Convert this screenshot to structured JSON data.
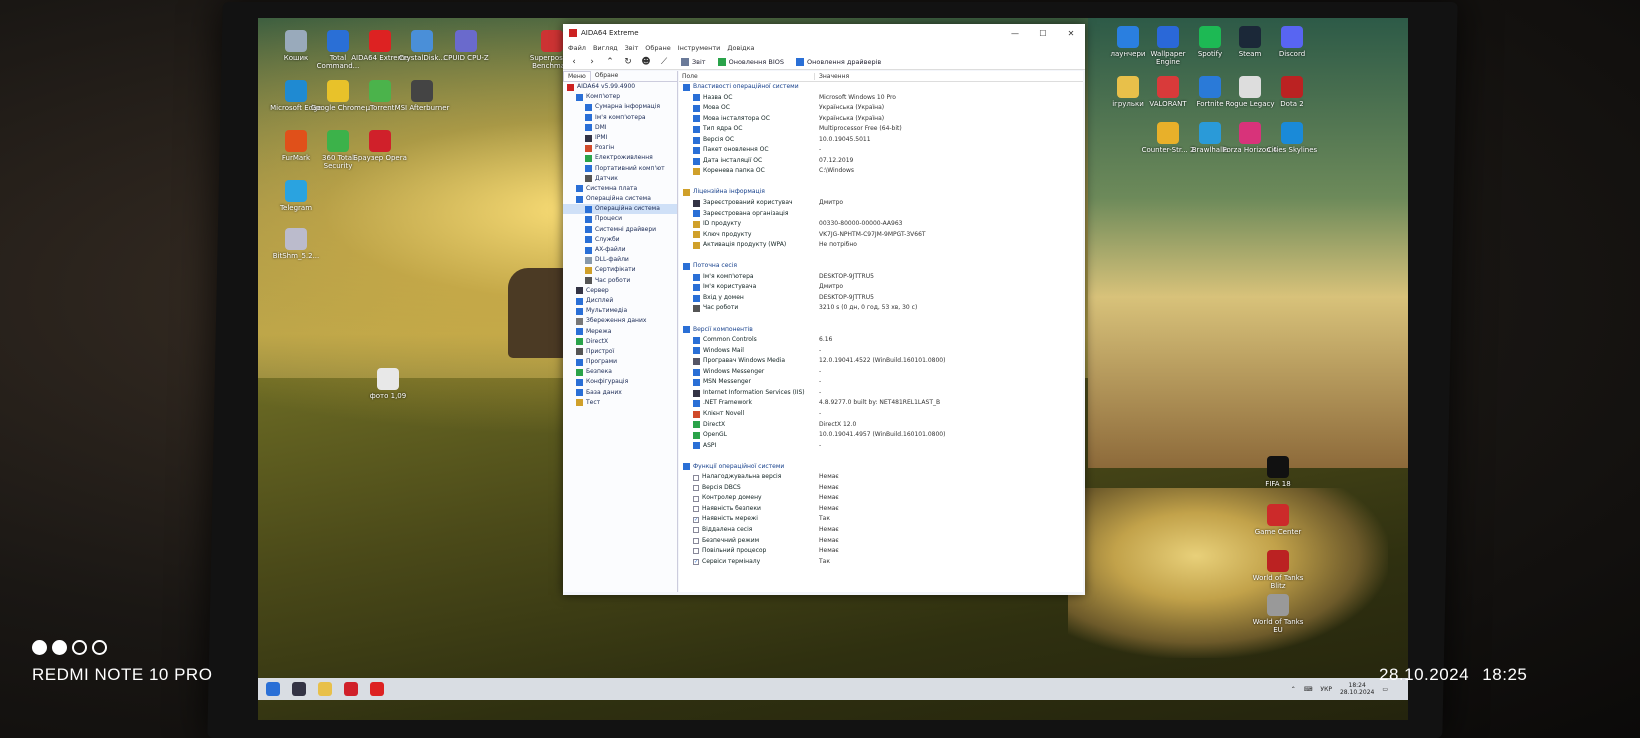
{
  "photo": {
    "device": "REDMI NOTE 10 PRO",
    "timestamp": "28.10.2024 18:25"
  },
  "desktop": {
    "left_icons": [
      {
        "label": "Кошик",
        "color": "#9ab"
      },
      {
        "label": "Total Command...",
        "color": "#2a6fd6"
      },
      {
        "label": "AIDA64 Extreme",
        "color": "#d22"
      },
      {
        "label": "CrystalDisk...",
        "color": "#4a8fd8"
      },
      {
        "label": "CPUID CPU-Z",
        "color": "#6a6acc"
      },
      {
        "label": "Superposit... Benchmark",
        "color": "#c33"
      },
      {
        "label": "Microsoft Edge",
        "color": "#1f8ad2"
      },
      {
        "label": "Google Chrome",
        "color": "#e8c22a"
      },
      {
        "label": "µTorrent",
        "color": "#4bb34b"
      },
      {
        "label": "MSI Afterburner",
        "color": "#444"
      },
      {
        "label": "FurMark",
        "color": "#e0501a"
      },
      {
        "label": "360 Total Security",
        "color": "#3cb24a"
      },
      {
        "label": "Браузер Opera",
        "color": "#d0202a"
      },
      {
        "label": "Telegram",
        "color": "#2aa3e0"
      },
      {
        "label": "BitShm_5.2...",
        "color": "#bbc"
      },
      {
        "label": "фото 1,09",
        "color": "#e8e8e8"
      }
    ],
    "right_icons": [
      {
        "label": "лаунчери",
        "color": "#2a7fe0"
      },
      {
        "label": "Wallpaper Engine",
        "color": "#2a68d8"
      },
      {
        "label": "Spotify",
        "color": "#1db954"
      },
      {
        "label": "Steam",
        "color": "#1b2838"
      },
      {
        "label": "Discord",
        "color": "#5865f2"
      },
      {
        "label": "ігрульки",
        "color": "#e8c04a"
      },
      {
        "label": "VALORANT",
        "color": "#d93a3a"
      },
      {
        "label": "Fortnite",
        "color": "#2a7ad8"
      },
      {
        "label": "Rogue Legacy",
        "color": "#ddd"
      },
      {
        "label": "Dota 2",
        "color": "#b22"
      },
      {
        "label": "Counter-Str... 2",
        "color": "#e8b02a"
      },
      {
        "label": "Brawlhalla",
        "color": "#2a9ad8"
      },
      {
        "label": "Forza Horizon 4",
        "color": "#d8337a"
      },
      {
        "label": "Cities Skylines",
        "color": "#1a8ad8"
      },
      {
        "label": "FIFA 18",
        "color": "#111"
      },
      {
        "label": "Game Center",
        "color": "#cc2a2a"
      },
      {
        "label": "World of Tanks Blitz",
        "color": "#b22"
      },
      {
        "label": "World of Tanks EU",
        "color": "#999"
      }
    ]
  },
  "window": {
    "title": "AIDA64 Extreme",
    "menu": [
      "Файл",
      "Вигляд",
      "Звіт",
      "Обране",
      "Інструменти",
      "Довідка"
    ],
    "toolbar": [
      {
        "label": "Звіт",
        "color": "#6a7a99"
      },
      {
        "label": "Оновлення BIOS",
        "color": "#2aa34a"
      },
      {
        "label": "Оновлення драйверів",
        "color": "#2a6fd6"
      }
    ],
    "left_tabs": [
      "Меню",
      "Обране"
    ],
    "tree": [
      {
        "label": "AIDA64 v5.99.4900",
        "indent": 0,
        "color": "#c22"
      },
      {
        "label": "Комп'ютер",
        "indent": 1,
        "color": "#2a6fd6"
      },
      {
        "label": "Сумарна інформація",
        "indent": 2,
        "color": "#2a6fd6"
      },
      {
        "label": "Ім'я комп'ютера",
        "indent": 2,
        "color": "#2a6fd6"
      },
      {
        "label": "DMI",
        "indent": 2,
        "color": "#2a6fd6"
      },
      {
        "label": "IPMI",
        "indent": 2,
        "color": "#334"
      },
      {
        "label": "Розгін",
        "indent": 2,
        "color": "#d04a2a"
      },
      {
        "label": "Електроживлення",
        "indent": 2,
        "color": "#2aa34a"
      },
      {
        "label": "Портативний комп'ют",
        "indent": 2,
        "color": "#2a6fd6"
      },
      {
        "label": "Датчик",
        "indent": 2,
        "color": "#555"
      },
      {
        "label": "Системна плата",
        "indent": 1,
        "color": "#2a6fd6"
      },
      {
        "label": "Операційна система",
        "indent": 1,
        "color": "#2a6fd6"
      },
      {
        "label": "Операційна система",
        "indent": 2,
        "color": "#2a6fd6",
        "selected": true
      },
      {
        "label": "Процеси",
        "indent": 2,
        "color": "#2a6fd6"
      },
      {
        "label": "Системні драйвери",
        "indent": 2,
        "color": "#2a6fd6"
      },
      {
        "label": "Служби",
        "indent": 2,
        "color": "#2a6fd6"
      },
      {
        "label": "AX-файли",
        "indent": 2,
        "color": "#2a6fd6"
      },
      {
        "label": "DLL-файли",
        "indent": 2,
        "color": "#8899aa"
      },
      {
        "label": "Сертифікати",
        "indent": 2,
        "color": "#d0a02a"
      },
      {
        "label": "Час роботи",
        "indent": 2,
        "color": "#555"
      },
      {
        "label": "Сервер",
        "indent": 1,
        "color": "#334"
      },
      {
        "label": "Дисплей",
        "indent": 1,
        "color": "#2a6fd6"
      },
      {
        "label": "Мультимедіа",
        "indent": 1,
        "color": "#2a6fd6"
      },
      {
        "label": "Збереження даних",
        "indent": 1,
        "color": "#777"
      },
      {
        "label": "Мережа",
        "indent": 1,
        "color": "#2a6fd6"
      },
      {
        "label": "DirectX",
        "indent": 1,
        "color": "#2aa34a"
      },
      {
        "label": "Пристрої",
        "indent": 1,
        "color": "#555"
      },
      {
        "label": "Програми",
        "indent": 1,
        "color": "#2a6fd6"
      },
      {
        "label": "Безпека",
        "indent": 1,
        "color": "#2aa34a"
      },
      {
        "label": "Конфігурація",
        "indent": 1,
        "color": "#2a6fd6"
      },
      {
        "label": "База даних",
        "indent": 1,
        "color": "#2a6fd6"
      },
      {
        "label": "Тест",
        "indent": 1,
        "color": "#d0a02a"
      }
    ],
    "columns": {
      "field": "Поле",
      "value": "Значення"
    },
    "rows": [
      {
        "type": "sec",
        "field": "Властивості операційної системи",
        "value": "",
        "color": "#2a6fd6"
      },
      {
        "type": "item",
        "field": "Назва ОС",
        "value": "Microsoft Windows 10 Pro",
        "color": "#2a6fd6"
      },
      {
        "type": "item",
        "field": "Мова ОС",
        "value": "Українська (Україна)",
        "color": "#2a6fd6"
      },
      {
        "type": "item",
        "field": "Мова інсталятора ОС",
        "value": "Українська (Україна)",
        "color": "#2a6fd6"
      },
      {
        "type": "item",
        "field": "Тип ядра ОС",
        "value": "Multiprocessor Free (64-bit)",
        "color": "#2a6fd6"
      },
      {
        "type": "item",
        "field": "Версія ОС",
        "value": "10.0.19045.5011",
        "color": "#2a6fd6"
      },
      {
        "type": "item",
        "field": "Пакет оновлення ОС",
        "value": "-",
        "color": "#2a6fd6"
      },
      {
        "type": "item",
        "field": "Дата інсталяції ОС",
        "value": "07.12.2019",
        "color": "#2a6fd6"
      },
      {
        "type": "item",
        "field": "Коренева папка ОС",
        "value": "C:\\Windows",
        "color": "#d0a02a"
      },
      {
        "type": "blank",
        "field": "",
        "value": ""
      },
      {
        "type": "sec",
        "field": "Ліцензійна інформація",
        "value": "",
        "color": "#d0a02a"
      },
      {
        "type": "item",
        "field": "Зареєстрований користувач",
        "value": "Дмитро",
        "color": "#334"
      },
      {
        "type": "item",
        "field": "Зареєстрована організація",
        "value": "",
        "color": "#2a6fd6"
      },
      {
        "type": "item",
        "field": "ID продукту",
        "value": "00330-80000-00000-AA963",
        "color": "#d0a02a"
      },
      {
        "type": "item",
        "field": "Ключ продукту",
        "value": "VK7JG-NPHTM-C97JM-9MPGT-3V66T",
        "color": "#d0a02a"
      },
      {
        "type": "item",
        "field": "Активація продукту (WPA)",
        "value": "Не потрібно",
        "color": "#d0a02a"
      },
      {
        "type": "blank",
        "field": "",
        "value": ""
      },
      {
        "type": "sec",
        "field": "Поточна сесія",
        "value": "",
        "color": "#2a6fd6"
      },
      {
        "type": "item",
        "field": "Ім'я комп'ютера",
        "value": "DESKTOP-9JTTRU5",
        "color": "#2a6fd6"
      },
      {
        "type": "item",
        "field": "Ім'я користувача",
        "value": "Дмитро",
        "color": "#2a6fd6"
      },
      {
        "type": "item",
        "field": "Вхід у домен",
        "value": "DESKTOP-9JTTRU5",
        "color": "#2a6fd6"
      },
      {
        "type": "item",
        "field": "Час роботи",
        "value": "3210 s (0 дн, 0 год, 53 хв, 30 с)",
        "color": "#555"
      },
      {
        "type": "blank",
        "field": "",
        "value": ""
      },
      {
        "type": "sec",
        "field": "Версії компонентів",
        "value": "",
        "color": "#2a6fd6"
      },
      {
        "type": "item",
        "field": "Common Controls",
        "value": "6.16",
        "color": "#2a6fd6"
      },
      {
        "type": "item",
        "field": "Windows Mail",
        "value": "-",
        "color": "#2a6fd6"
      },
      {
        "type": "item",
        "field": "Програвач Windows Media",
        "value": "12.0.19041.4522 (WinBuild.160101.0800)",
        "color": "#556"
      },
      {
        "type": "item",
        "field": "Windows Messenger",
        "value": "-",
        "color": "#2a6fd6"
      },
      {
        "type": "item",
        "field": "MSN Messenger",
        "value": "-",
        "color": "#2a6fd6"
      },
      {
        "type": "item",
        "field": "Internet Information Services (IIS)",
        "value": "-",
        "color": "#334"
      },
      {
        "type": "item",
        "field": ".NET Framework",
        "value": "4.8.9277.0 built by: NET481REL1LAST_B",
        "color": "#2a6fd6"
      },
      {
        "type": "item",
        "field": "Клієнт Novell",
        "value": "-",
        "color": "#d04a2a"
      },
      {
        "type": "item",
        "field": "DirectX",
        "value": "DirectX 12.0",
        "color": "#2aa34a"
      },
      {
        "type": "item",
        "field": "OpenGL",
        "value": "10.0.19041.4957 (WinBuild.160101.0800)",
        "color": "#2aa34a"
      },
      {
        "type": "item",
        "field": "ASPI",
        "value": "-",
        "color": "#2a6fd6"
      },
      {
        "type": "blank",
        "field": "",
        "value": ""
      },
      {
        "type": "sec",
        "field": "Функції операційної системи",
        "value": "",
        "color": "#2a6fd6"
      },
      {
        "type": "check",
        "field": "Налагоджувальна версія",
        "value": "Немає",
        "checked": false
      },
      {
        "type": "check",
        "field": "Версія DBCS",
        "value": "Немає",
        "checked": false
      },
      {
        "type": "check",
        "field": "Контролер домену",
        "value": "Немає",
        "checked": false
      },
      {
        "type": "check",
        "field": "Наявність безпеки",
        "value": "Немає",
        "checked": false
      },
      {
        "type": "check",
        "field": "Наявність мережі",
        "value": "Так",
        "checked": true
      },
      {
        "type": "check",
        "field": "Віддалена сесія",
        "value": "Немає",
        "checked": false
      },
      {
        "type": "check",
        "field": "Безпечний режим",
        "value": "Немає",
        "checked": false
      },
      {
        "type": "check",
        "field": "Повільний процесор",
        "value": "Немає",
        "checked": false
      },
      {
        "type": "check",
        "field": "Сервіси терміналу",
        "value": "Так",
        "checked": true
      }
    ]
  },
  "taskbar": {
    "apps": [
      {
        "name": "start",
        "color": "#2a6fd6"
      },
      {
        "name": "search",
        "color": "#334"
      },
      {
        "name": "explorer",
        "color": "#e8c04a"
      },
      {
        "name": "opera",
        "color": "#d0202a"
      },
      {
        "name": "aida64",
        "color": "#d22"
      }
    ],
    "lang": "УКР",
    "time": "18:24",
    "date": "28.10.2024"
  }
}
